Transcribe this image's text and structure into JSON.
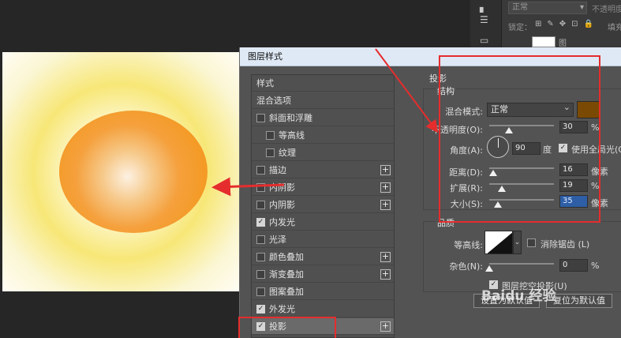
{
  "layers_panel": {
    "blend_mode": "正常",
    "opacity_label": "不透明度",
    "lock_label": "锁定：",
    "fill_label": "填充",
    "layer_label": "图"
  },
  "dialog": {
    "title": "图层样式",
    "styles": [
      {
        "label": "样式",
        "checkbox": false,
        "checked": false,
        "plus": false,
        "indent": false
      },
      {
        "label": "混合选项",
        "checkbox": false,
        "checked": false,
        "plus": false,
        "indent": false
      },
      {
        "label": "斜面和浮雕",
        "checkbox": true,
        "checked": false,
        "plus": false,
        "indent": false
      },
      {
        "label": "等高线",
        "checkbox": true,
        "checked": false,
        "plus": false,
        "indent": true
      },
      {
        "label": "纹理",
        "checkbox": true,
        "checked": false,
        "plus": false,
        "indent": true
      },
      {
        "label": "描边",
        "checkbox": true,
        "checked": false,
        "plus": true,
        "indent": false
      },
      {
        "label": "内阴影",
        "checkbox": true,
        "checked": false,
        "plus": true,
        "indent": false
      },
      {
        "label": "内阴影",
        "checkbox": true,
        "checked": false,
        "plus": true,
        "indent": false
      },
      {
        "label": "内发光",
        "checkbox": true,
        "checked": true,
        "plus": false,
        "indent": false
      },
      {
        "label": "光泽",
        "checkbox": true,
        "checked": false,
        "plus": false,
        "indent": false
      },
      {
        "label": "颜色叠加",
        "checkbox": true,
        "checked": false,
        "plus": true,
        "indent": false
      },
      {
        "label": "渐变叠加",
        "checkbox": true,
        "checked": false,
        "plus": true,
        "indent": false
      },
      {
        "label": "图案叠加",
        "checkbox": true,
        "checked": false,
        "plus": false,
        "indent": false
      },
      {
        "label": "外发光",
        "checkbox": true,
        "checked": true,
        "plus": false,
        "indent": false
      },
      {
        "label": "投影",
        "checkbox": true,
        "checked": true,
        "plus": true,
        "indent": false,
        "selected": true
      }
    ],
    "section_title": "投影",
    "structure": {
      "title": "结构",
      "blend_mode_label": "混合模式:",
      "blend_mode_value": "正常",
      "shadow_color": "#7a4a04",
      "opacity_label": "不透明度(O):",
      "opacity_value": "30",
      "opacity_unit": "%",
      "opacity_level": 0.3,
      "angle_label": "角度(A):",
      "angle_value": "90",
      "angle_unit": "度",
      "global_light_label": "使用全局光(G",
      "global_light_checked": true,
      "distance_label": "距离(D):",
      "distance_value": "16",
      "distance_unit": "像素",
      "distance_level": 0.06,
      "spread_label": "扩展(R):",
      "spread_value": "19",
      "spread_unit": "%",
      "spread_level": 0.19,
      "size_label": "大小(S):",
      "size_value": "35",
      "size_unit": "像素",
      "size_level": 0.14
    },
    "quality": {
      "title": "品质",
      "contour_label": "等高线:",
      "anti_alias_label": "消除锯齿 (L)",
      "anti_alias_checked": false,
      "noise_label": "杂色(N):",
      "noise_value": "0",
      "noise_unit": "%",
      "noise_level": 0.0
    },
    "knockout_label": "图层挖空投影(U)",
    "knockout_checked": true,
    "default_button": "设置为默认值",
    "reset_button": "复位为默认值"
  },
  "watermark_text": "Baidu 经验",
  "colors": {
    "annotation_red": "#e52d2d",
    "sun_orange": "#f49a25",
    "glow_yellow": "#f7e777"
  }
}
